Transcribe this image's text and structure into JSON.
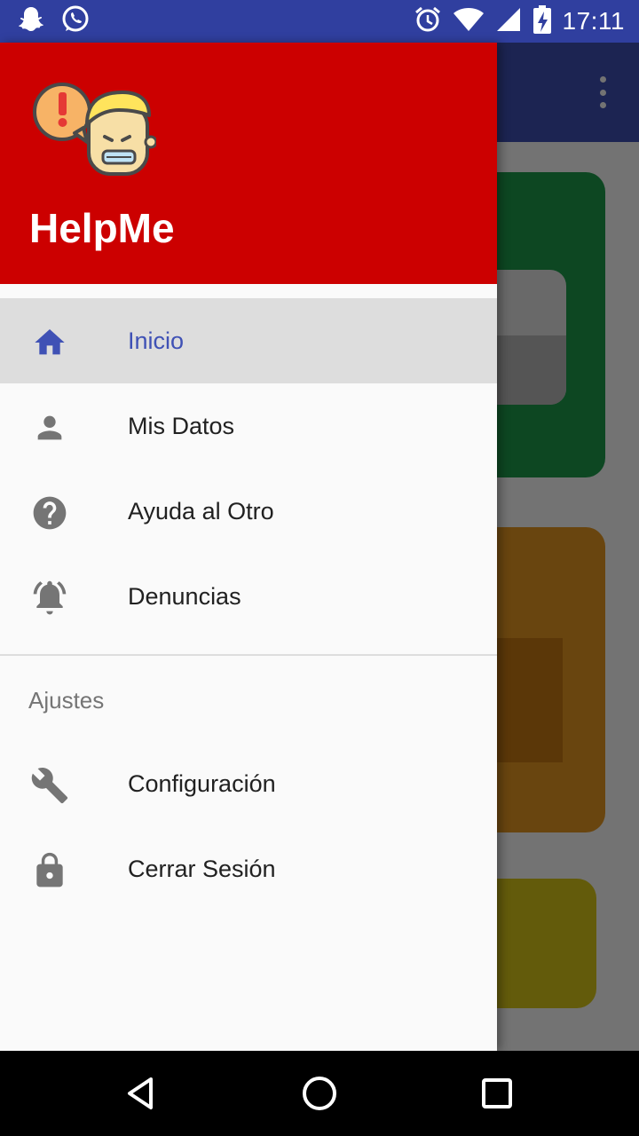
{
  "status_bar": {
    "time": "17:11",
    "left_icons": [
      "snapchat-icon",
      "whatsapp-icon"
    ],
    "right_icons": [
      "alarm-icon",
      "wifi-icon",
      "signal-icon",
      "battery-charging-icon"
    ]
  },
  "background_app": {
    "toolbar_color": "#3F51B5",
    "overflow_icon": "more-vert-icon",
    "cards": [
      {
        "color": "#1E9E4D"
      },
      {
        "color": "#E89A22"
      },
      {
        "color": "#DCCB1A"
      }
    ]
  },
  "drawer": {
    "header_color": "#CC0000",
    "app_name": "HelpMe",
    "logo_icon": "helpme-logo",
    "accent_color": "#3F51B5",
    "items": [
      {
        "label": "Inicio",
        "icon": "home-icon",
        "selected": true
      },
      {
        "label": "Mis Datos",
        "icon": "person-icon",
        "selected": false
      },
      {
        "label": "Ayuda al Otro",
        "icon": "help-icon",
        "selected": false
      },
      {
        "label": "Denuncias",
        "icon": "notifications-active-icon",
        "selected": false
      }
    ],
    "section_title": "Ajustes",
    "settings_items": [
      {
        "label": "Configuración",
        "icon": "wrench-icon"
      },
      {
        "label": "Cerrar Sesión",
        "icon": "lock-icon"
      }
    ]
  },
  "nav_bar": {
    "buttons": [
      "back-icon",
      "home-circle-icon",
      "recents-icon"
    ]
  }
}
